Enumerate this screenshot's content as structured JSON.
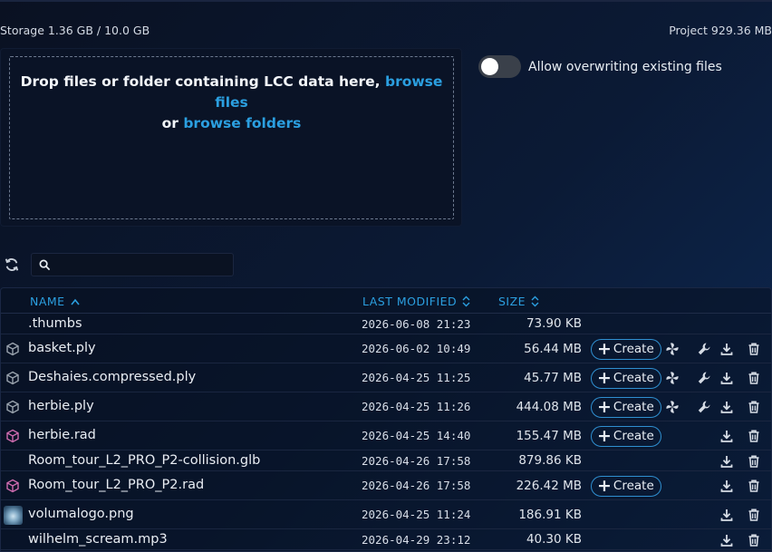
{
  "storage_label": "Storage 1.36 GB / 10.0 GB",
  "project_label": "Project 929.36 MB",
  "dropzone": {
    "text_before": "Drop files or folder containing LCC data here, ",
    "browse_files": "browse files",
    "or_text": "or ",
    "browse_folders": "browse folders"
  },
  "overwrite": {
    "label": "Allow overwriting existing files",
    "enabled": false
  },
  "search": {
    "placeholder": "",
    "value": ""
  },
  "columns": {
    "name": "NAME",
    "modified": "LAST MODIFIED",
    "size": "SIZE"
  },
  "create_label": "Create",
  "files": [
    {
      "name": ".thumbs",
      "modified": "2026-06-08 21:23",
      "size": "73.90 KB",
      "icon": "none",
      "create": false,
      "extra_actions": false,
      "file_actions": false
    },
    {
      "name": "basket.ply",
      "modified": "2026-06-02 10:49",
      "size": "56.44 MB",
      "icon": "cube-gray",
      "create": true,
      "extra_actions": true,
      "file_actions": true
    },
    {
      "name": "Deshaies.compressed.ply",
      "modified": "2026-04-25 11:25",
      "size": "45.77 MB",
      "icon": "cube-gray",
      "create": true,
      "extra_actions": true,
      "file_actions": true
    },
    {
      "name": "herbie.ply",
      "modified": "2026-04-25 11:26",
      "size": "444.08 MB",
      "icon": "cube-gray",
      "create": true,
      "extra_actions": true,
      "file_actions": true
    },
    {
      "name": "herbie.rad",
      "modified": "2026-04-25 14:40",
      "size": "155.47 MB",
      "icon": "cube-pink",
      "create": true,
      "extra_actions": false,
      "file_actions": true
    },
    {
      "name": "Room_tour_L2_PRO_P2-collision.glb",
      "modified": "2026-04-26 17:58",
      "size": "879.86 KB",
      "icon": "none",
      "create": false,
      "extra_actions": false,
      "file_actions": true
    },
    {
      "name": "Room_tour_L2_PRO_P2.rad",
      "modified": "2026-04-26 17:58",
      "size": "226.42 MB",
      "icon": "cube-pink",
      "create": true,
      "extra_actions": false,
      "file_actions": true
    },
    {
      "name": "volumalogo.png",
      "modified": "2026-04-25 11:24",
      "size": "186.91 KB",
      "icon": "image-thumb",
      "create": false,
      "extra_actions": false,
      "file_actions": true
    },
    {
      "name": "wilhelm_scream.mp3",
      "modified": "2026-04-29 23:12",
      "size": "40.30 KB",
      "icon": "none",
      "create": false,
      "extra_actions": false,
      "file_actions": true
    }
  ],
  "colors": {
    "accent": "#2b9fe0",
    "cube_gray": "#9aa3ae",
    "cube_pink": "#d06cb0",
    "background": "#0b1a35"
  }
}
